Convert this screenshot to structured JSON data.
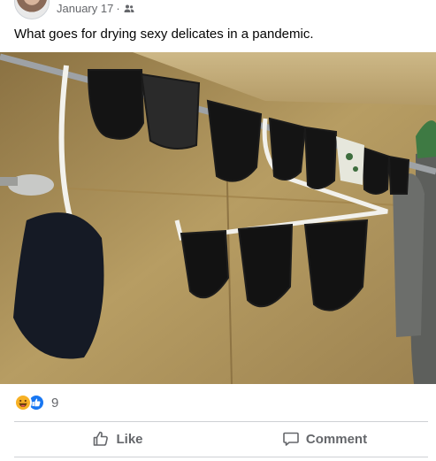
{
  "post": {
    "date": "January 17",
    "separator": "·",
    "audience_icon": "friends-icon",
    "text": "What goes for drying sexy delicates in a pandemic."
  },
  "reactions": {
    "icons": [
      "haha-reaction-icon",
      "like-reaction-icon"
    ],
    "count": "9"
  },
  "actions": {
    "like_label": "Like",
    "comment_label": "Comment"
  },
  "colors": {
    "meta_text": "#65676b",
    "like_blue": "#1877f2",
    "haha_yellow": "#f7b125",
    "divider": "#ced0d4"
  }
}
